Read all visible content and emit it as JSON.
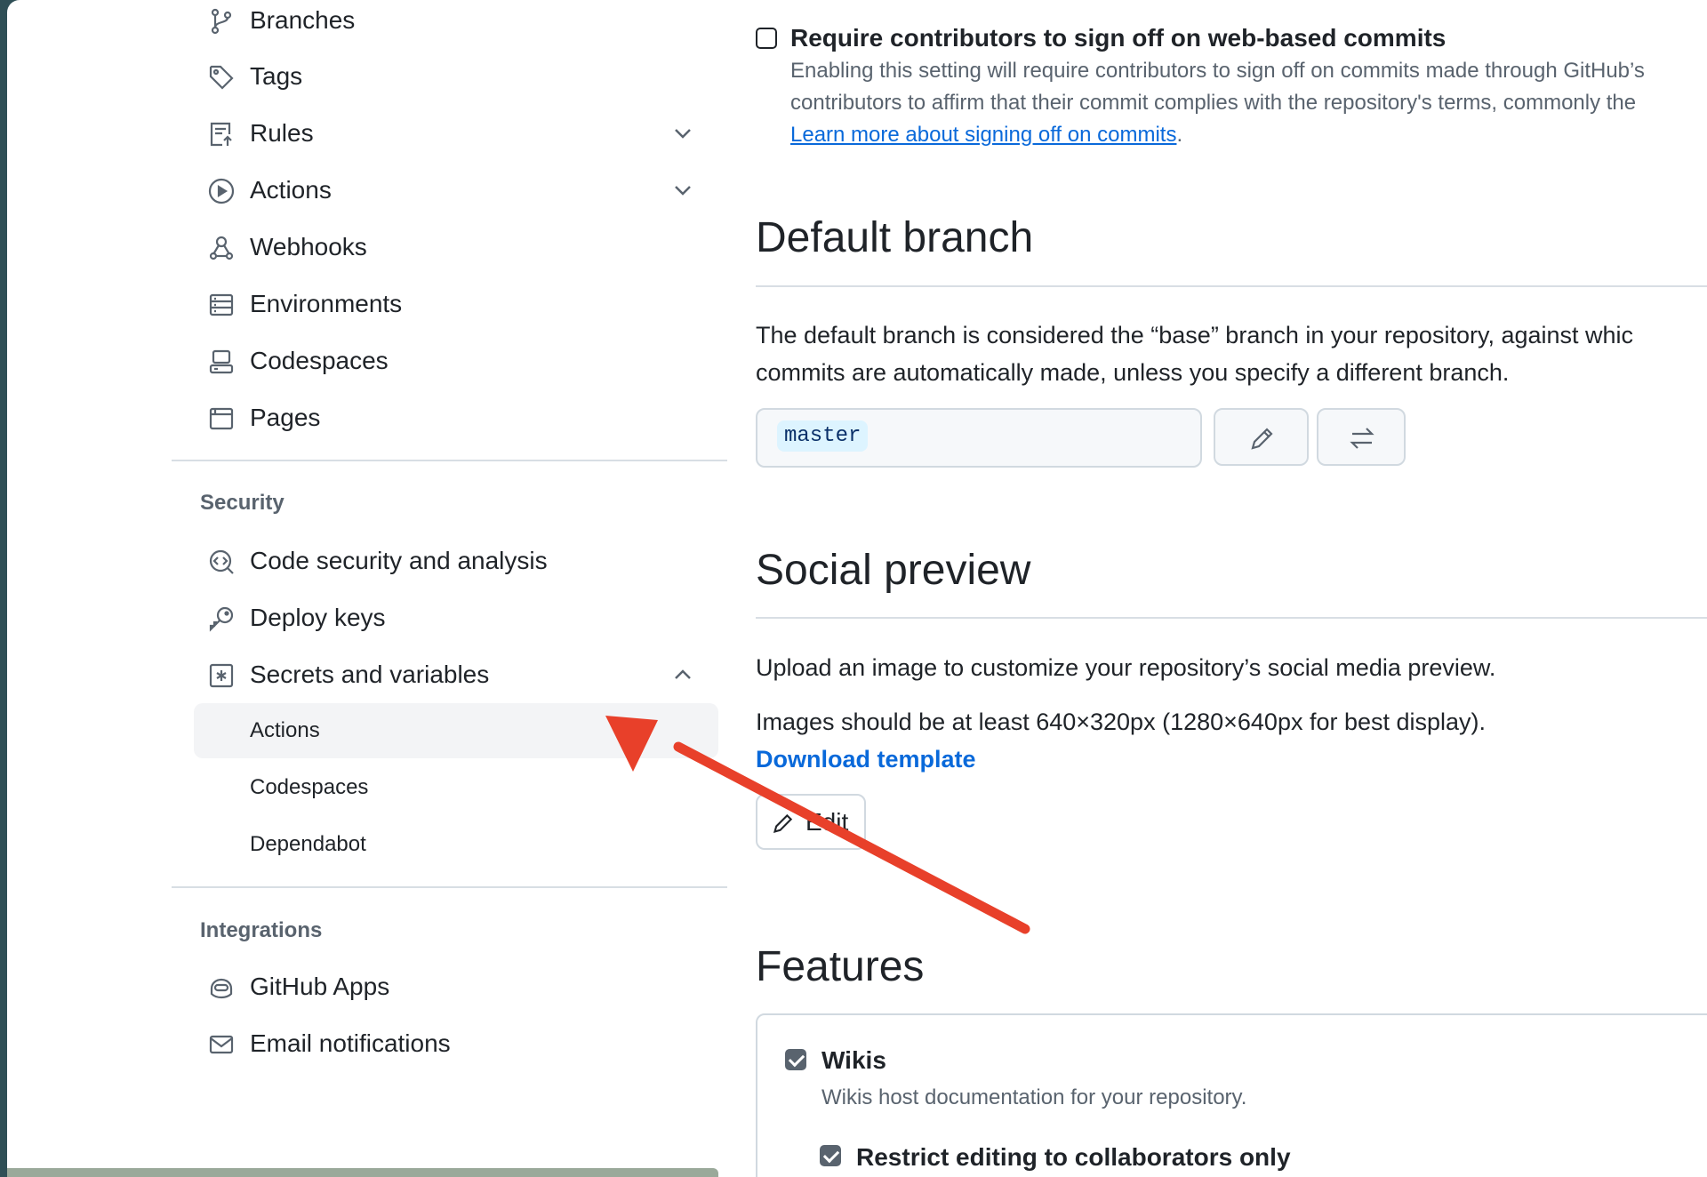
{
  "sidebar": {
    "code_items": [
      {
        "label": "Branches",
        "icon": "git-branch-icon"
      },
      {
        "label": "Tags",
        "icon": "tag-icon"
      },
      {
        "label": "Rules",
        "icon": "rules-icon",
        "expandable": true
      },
      {
        "label": "Actions",
        "icon": "play-icon",
        "expandable": true
      },
      {
        "label": "Webhooks",
        "icon": "webhook-icon"
      },
      {
        "label": "Environments",
        "icon": "server-icon"
      },
      {
        "label": "Codespaces",
        "icon": "codespaces-icon"
      },
      {
        "label": "Pages",
        "icon": "browser-icon"
      }
    ],
    "security_heading": "Security",
    "security_items": [
      {
        "label": "Code security and analysis",
        "icon": "codescan-icon"
      },
      {
        "label": "Deploy keys",
        "icon": "key-icon"
      },
      {
        "label": "Secrets and variables",
        "icon": "asterisk-box-icon",
        "expanded": true
      }
    ],
    "secrets_subitems": [
      {
        "label": "Actions",
        "active": true
      },
      {
        "label": "Codespaces"
      },
      {
        "label": "Dependabot"
      }
    ],
    "integrations_heading": "Integrations",
    "integration_items": [
      {
        "label": "GitHub Apps",
        "icon": "copilot-icon"
      },
      {
        "label": "Email notifications",
        "icon": "mail-icon"
      }
    ]
  },
  "signoff": {
    "label": "Require contributors to sign off on web-based commits",
    "description_line1": "Enabling this setting will require contributors to sign off on commits made through GitHub’s",
    "description_line2": "contributors to affirm that their commit complies with the repository's terms, commonly the",
    "link": "Learn more about signing off on commits",
    "link_suffix": "."
  },
  "default_branch": {
    "title": "Default branch",
    "desc_line1": "The default branch is considered the “base” branch in your repository, against whic",
    "desc_line2": "commits are automatically made, unless you specify a different branch.",
    "branch_name": "master"
  },
  "social_preview": {
    "title": "Social preview",
    "desc": "Upload an image to customize your repository’s social media preview.",
    "size_note": "Images should be at least 640×320px (1280×640px for best display).",
    "download_link": "Download template",
    "edit_label": "Edit"
  },
  "features": {
    "title": "Features",
    "wikis_label": "Wikis",
    "wikis_desc": "Wikis host documentation for your repository.",
    "restrict_label": "Restrict editing to collaborators only"
  },
  "colors": {
    "link": "#0969da",
    "annotation_arrow": "#e8402a",
    "desktop": "#2f4f56"
  }
}
